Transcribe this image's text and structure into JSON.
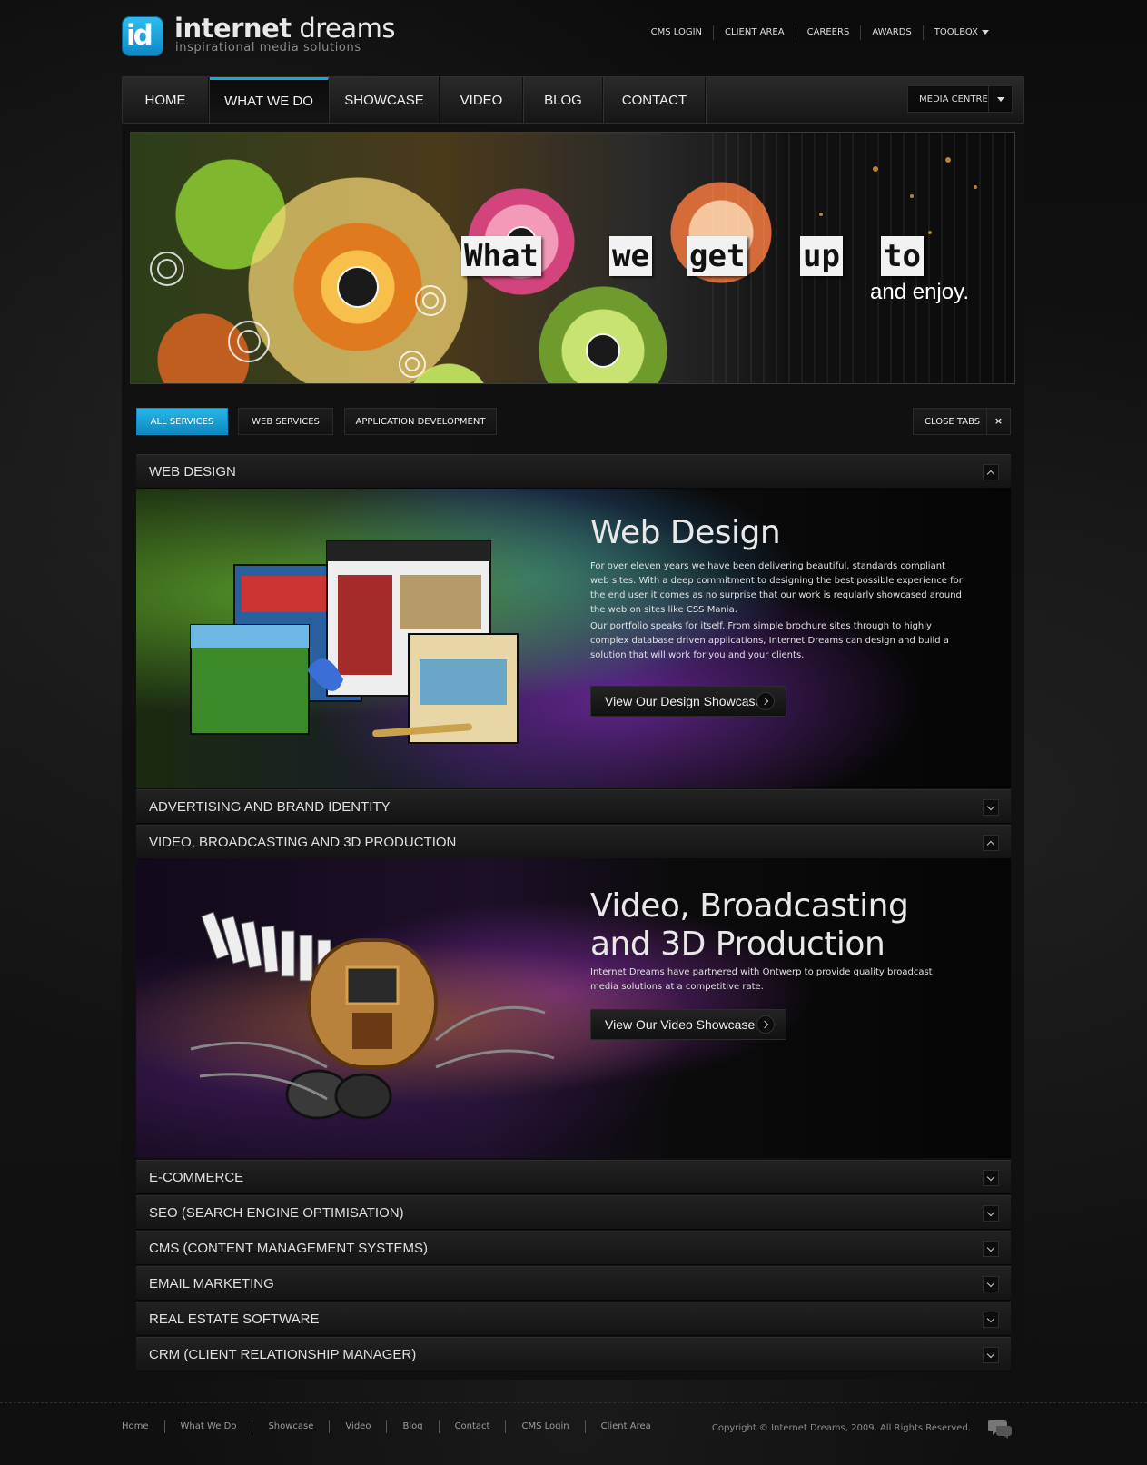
{
  "brand": {
    "logo_mark": "id",
    "name_bold": "internet",
    "name_rest": " dreams",
    "tagline": "inspirational media solutions"
  },
  "util_nav": [
    "CMS LOGIN",
    "CLIENT AREA",
    "CAREERS",
    "AWARDS",
    "TOOLBOX"
  ],
  "main_nav": {
    "items": [
      "HOME",
      "WHAT WE DO",
      "SHOWCASE",
      "VIDEO",
      "BLOG",
      "CONTACT"
    ],
    "active": "WHAT WE DO",
    "media_centre": "MEDIA CENTRE"
  },
  "banner": {
    "words": [
      "What",
      "we",
      "get",
      "up",
      "to"
    ],
    "sub": "and enjoy."
  },
  "tabs": {
    "items": [
      "ALL SERVICES",
      "WEB SERVICES",
      "APPLICATION DEVELOPMENT"
    ],
    "active": "ALL SERVICES",
    "close_label": "CLOSE TABS",
    "close_icon": "×"
  },
  "services": [
    {
      "title": "WEB DESIGN",
      "expanded": true,
      "heading": "Web Design",
      "paragraphs": [
        "For over eleven years we have been delivering beautiful, standards compliant web sites. With a deep commitment to designing the best possible experience for the end user it comes as no surprise that our work is regularly showcased around the web on sites like CSS Mania.",
        "Our portfolio speaks for itself. From simple brochure sites through to highly complex database driven applications, Internet Dreams can design and build a solution that will work for you and your clients."
      ],
      "cta": "View Our Design Showcase"
    },
    {
      "title": "ADVERTISING AND BRAND IDENTITY",
      "expanded": false
    },
    {
      "title": "VIDEO, BROADCASTING AND 3D PRODUCTION",
      "expanded": true,
      "heading_line1": "Video, Broadcasting",
      "heading_line2": "and 3D Production",
      "paragraphs": [
        "Internet Dreams have partnered with Ontwerp to provide quality broadcast media solutions at a competitive rate."
      ],
      "cta": "View Our Video Showcase"
    },
    {
      "title": "E-COMMERCE",
      "expanded": false
    },
    {
      "title": "SEO (SEARCH ENGINE OPTIMISATION)",
      "expanded": false
    },
    {
      "title": "CMS (CONTENT MANAGEMENT SYSTEMS)",
      "expanded": false
    },
    {
      "title": "EMAIL MARKETING",
      "expanded": false
    },
    {
      "title": "REAL ESTATE SOFTWARE",
      "expanded": false
    },
    {
      "title": "CRM (CLIENT RELATIONSHIP MANAGER)",
      "expanded": false
    }
  ],
  "footer": {
    "links": [
      "Home",
      "What We Do",
      "Showcase",
      "Video",
      "Blog",
      "Contact",
      "CMS Login",
      "Client Area"
    ],
    "copyright": "Copyright © Internet Dreams, 2009. All Rights Reserved."
  },
  "colors": {
    "accent": "#19a8dd",
    "background": "#111111"
  }
}
